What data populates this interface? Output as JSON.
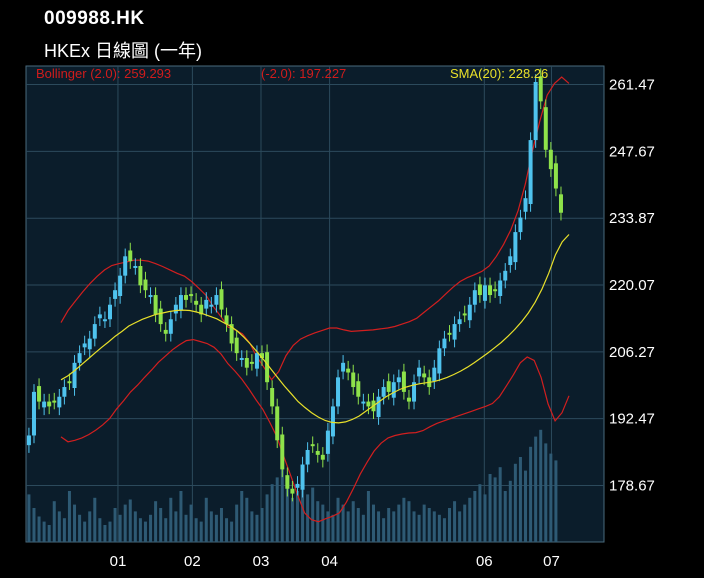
{
  "chart_data": {
    "type": "candlestick",
    "title": "009988.HK",
    "subtitle": "HKEx 日線圖 (一年)",
    "legend": {
      "bollinger_upper": "Bollinger (2.0): 259.293",
      "bollinger_lower": "(-2.0): 197.227",
      "sma": "SMA(20): 228.26"
    },
    "y_ticks": [
      261.47,
      247.67,
      233.87,
      220.07,
      206.27,
      192.47,
      178.67
    ],
    "y_tick_labels": [
      "261.47",
      "247.67",
      "233.87",
      "220.07",
      "206.27",
      "192.47",
      "178.67"
    ],
    "ylim": [
      167.0,
      265.3
    ],
    "x_tick_labels": [
      "01",
      "02",
      "03",
      "04",
      "06",
      "07"
    ],
    "x_tick_positions": [
      0.15,
      2.7,
      5.05,
      7.4,
      12.7,
      15.0
    ],
    "xlim": [
      -3.0,
      16.8
    ],
    "grid": true,
    "close": [
      189,
      198,
      196,
      196,
      195,
      196,
      197,
      199,
      200,
      204,
      206,
      208,
      209,
      212,
      214,
      213,
      216,
      219,
      222,
      226,
      225,
      224,
      220,
      219,
      218,
      214,
      212,
      210,
      213,
      216,
      218,
      217,
      218,
      216,
      214,
      217,
      216,
      218,
      215,
      212,
      208,
      206,
      205,
      203,
      204,
      206,
      205,
      200,
      195,
      188,
      182,
      178,
      177,
      179,
      183,
      186,
      187,
      185,
      184,
      190,
      195,
      201,
      204,
      202,
      199,
      197,
      196,
      195,
      194,
      197,
      199,
      198,
      200,
      201,
      198,
      196,
      200,
      203,
      201,
      199,
      203,
      207,
      209,
      210,
      212,
      213,
      214,
      216,
      219,
      218,
      220,
      218,
      219,
      221,
      223,
      226,
      231,
      234,
      238,
      250,
      262,
      258,
      248,
      244,
      240,
      235
    ],
    "sma20": [
      200.5,
      201.3,
      202.4,
      203.6,
      204.8,
      206.0,
      207.2,
      208.3,
      209.5,
      210.5,
      211.6,
      212.3,
      213.0,
      213.5,
      214.0,
      214.3,
      214.6,
      214.8,
      214.9,
      214.8,
      214.5,
      214.1,
      213.6,
      213.1,
      212.3,
      211.6,
      210.6,
      209.3,
      207.8,
      206.2,
      204.5,
      202.7,
      200.9,
      199.2,
      197.6,
      196.0,
      194.8,
      193.7,
      192.8,
      192.1,
      191.7,
      191.6,
      191.8,
      192.3,
      193.0,
      194.0,
      195.0,
      196.0,
      197.0,
      197.8,
      198.5,
      199.0,
      199.4,
      199.7,
      199.9,
      200.1,
      200.5,
      201.0,
      201.6,
      202.3,
      203.1,
      204.0,
      205.0,
      206.0,
      207.1,
      208.2,
      209.5,
      210.9,
      212.5,
      214.3,
      216.5,
      219.2,
      222.5,
      226.3,
      229.0,
      230.5
    ],
    "bollinger_upper": [
      212.3,
      214.9,
      216.8,
      218.7,
      220.4,
      221.9,
      223.2,
      224.1,
      224.5,
      224.8,
      225.2,
      225.2,
      225.0,
      224.5,
      223.9,
      223.2,
      222.5,
      221.9,
      220.8,
      219.4,
      217.9,
      215.6,
      213.6,
      211.4,
      210.8,
      210.0,
      208.1,
      205.2,
      203.0,
      200.5,
      202.2,
      205.5,
      207.6,
      208.9,
      209.6,
      210.2,
      210.7,
      211.2,
      211.2,
      210.8,
      210.5,
      210.6,
      210.7,
      210.8,
      211.0,
      211.2,
      211.5,
      212.0,
      212.5,
      213.2,
      214.4,
      215.6,
      216.8,
      218.2,
      219.6,
      220.8,
      221.6,
      222.2,
      222.9,
      224.0,
      226.0,
      228.5,
      231.5,
      235.5,
      241.0,
      248.0,
      254.0,
      259.3,
      261.7,
      263.0,
      261.7
    ],
    "bollinger_lower": [
      188.7,
      187.7,
      188.0,
      188.5,
      189.2,
      190.1,
      191.2,
      192.5,
      194.5,
      196.2,
      198.0,
      199.4,
      201.0,
      202.5,
      204.1,
      205.4,
      206.7,
      207.7,
      208.6,
      208.8,
      208.4,
      208.0,
      207.2,
      205.8,
      203.8,
      202.3,
      200.6,
      198.6,
      196.4,
      194.4,
      191.7,
      188.8,
      184.7,
      180.8,
      176.7,
      173.0,
      171.6,
      171.2,
      171.8,
      172.3,
      173.0,
      175.2,
      178.0,
      181.0,
      183.5,
      185.8,
      187.4,
      188.5,
      189.0,
      189.3,
      189.5,
      189.6,
      190.0,
      190.8,
      191.5,
      192.0,
      192.5,
      193.0,
      193.5,
      194.0,
      194.5,
      195.0,
      195.6,
      197.0,
      199.2,
      201.5,
      204.0,
      205.2,
      204.5,
      201.0,
      195.5,
      192.0,
      193.7,
      197.2
    ],
    "volume": [
      28,
      20,
      15,
      12,
      10,
      24,
      18,
      14,
      30,
      22,
      16,
      12,
      18,
      26,
      14,
      10,
      12,
      20,
      16,
      22,
      25,
      18,
      14,
      12,
      16,
      24,
      20,
      14,
      26,
      18,
      30,
      16,
      22,
      14,
      12,
      26,
      18,
      16,
      20,
      14,
      12,
      22,
      30,
      26,
      18,
      16,
      20,
      28,
      34,
      38,
      45,
      36,
      26,
      30,
      34,
      28,
      32,
      24,
      22,
      18,
      16,
      26,
      22,
      18,
      24,
      20,
      16,
      30,
      22,
      18,
      14,
      20,
      18,
      22,
      26,
      24,
      18,
      16,
      22,
      20,
      18,
      16,
      14,
      20,
      24,
      18,
      22,
      26,
      30,
      34,
      28,
      40,
      38,
      44,
      30,
      36,
      46,
      50,
      42,
      56,
      62,
      66,
      58,
      52,
      48
    ]
  }
}
